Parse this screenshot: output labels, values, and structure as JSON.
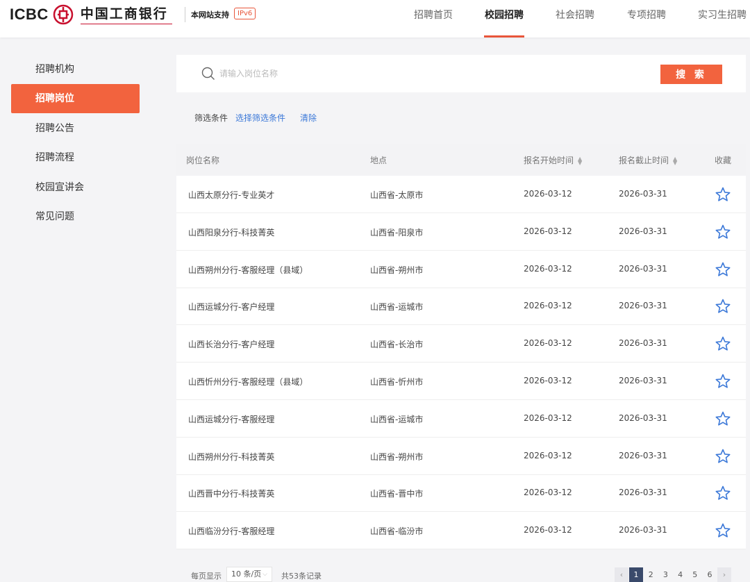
{
  "header": {
    "logo_en": "ICBC",
    "logo_cn": "中国工商银行",
    "ipv6_text": "本网站支持",
    "ipv6_badge": "IPv6",
    "nav": [
      {
        "label": "招聘首页",
        "active": false
      },
      {
        "label": "校园招聘",
        "active": true
      },
      {
        "label": "社会招聘",
        "active": false
      },
      {
        "label": "专项招聘",
        "active": false
      },
      {
        "label": "实习生招聘",
        "active": false
      }
    ]
  },
  "sidebar": {
    "items": [
      {
        "label": "招聘机构",
        "active": false
      },
      {
        "label": "招聘岗位",
        "active": true
      },
      {
        "label": "招聘公告",
        "active": false
      },
      {
        "label": "招聘流程",
        "active": false
      },
      {
        "label": "校园宣讲会",
        "active": false
      },
      {
        "label": "常见问题",
        "active": false
      }
    ]
  },
  "search": {
    "placeholder": "请输入岗位名称",
    "value": "",
    "button_label": "搜 索"
  },
  "filter": {
    "label": "筛选条件",
    "select_label": "选择筛选条件",
    "clear_label": "清除"
  },
  "table": {
    "columns": [
      "岗位名称",
      "地点",
      "报名开始时间",
      "报名截止时间",
      "收藏"
    ],
    "rows": [
      {
        "title": "山西太原分行-专业英才",
        "location": "山西省-太原市",
        "start": "2026-03-12",
        "end": "2026-03-31"
      },
      {
        "title": "山西阳泉分行-科技菁英",
        "location": "山西省-阳泉市",
        "start": "2026-03-12",
        "end": "2026-03-31"
      },
      {
        "title": "山西朔州分行-客服经理（县域）",
        "location": "山西省-朔州市",
        "start": "2026-03-12",
        "end": "2026-03-31"
      },
      {
        "title": "山西运城分行-客户经理",
        "location": "山西省-运城市",
        "start": "2026-03-12",
        "end": "2026-03-31"
      },
      {
        "title": "山西长治分行-客户经理",
        "location": "山西省-长治市",
        "start": "2026-03-12",
        "end": "2026-03-31"
      },
      {
        "title": "山西忻州分行-客服经理（县域）",
        "location": "山西省-忻州市",
        "start": "2026-03-12",
        "end": "2026-03-31"
      },
      {
        "title": "山西运城分行-客服经理",
        "location": "山西省-运城市",
        "start": "2026-03-12",
        "end": "2026-03-31"
      },
      {
        "title": "山西朔州分行-科技菁英",
        "location": "山西省-朔州市",
        "start": "2026-03-12",
        "end": "2026-03-31"
      },
      {
        "title": "山西晋中分行-科技菁英",
        "location": "山西省-晋中市",
        "start": "2026-03-12",
        "end": "2026-03-31"
      },
      {
        "title": "山西临汾分行-客服经理",
        "location": "山西省-临汾市",
        "start": "2026-03-12",
        "end": "2026-03-31"
      }
    ]
  },
  "pagination": {
    "per_page_label": "每页显示",
    "per_page_value": "10 条/页",
    "total_label": "共53条记录",
    "pages": [
      "1",
      "2",
      "3",
      "4",
      "5",
      "6"
    ],
    "current_page": "1",
    "prev_symbol": "‹",
    "next_symbol": "›"
  },
  "colors": {
    "accent": "#f2633e",
    "link": "#3b78d8",
    "active_page": "#3a4a6b",
    "star": "#3b78d8"
  },
  "icons": [
    "icbc-seal-icon",
    "search-icon",
    "star-outline-icon",
    "chevron-down-icon",
    "chevron-left-icon",
    "chevron-right-icon",
    "sort-icon"
  ]
}
